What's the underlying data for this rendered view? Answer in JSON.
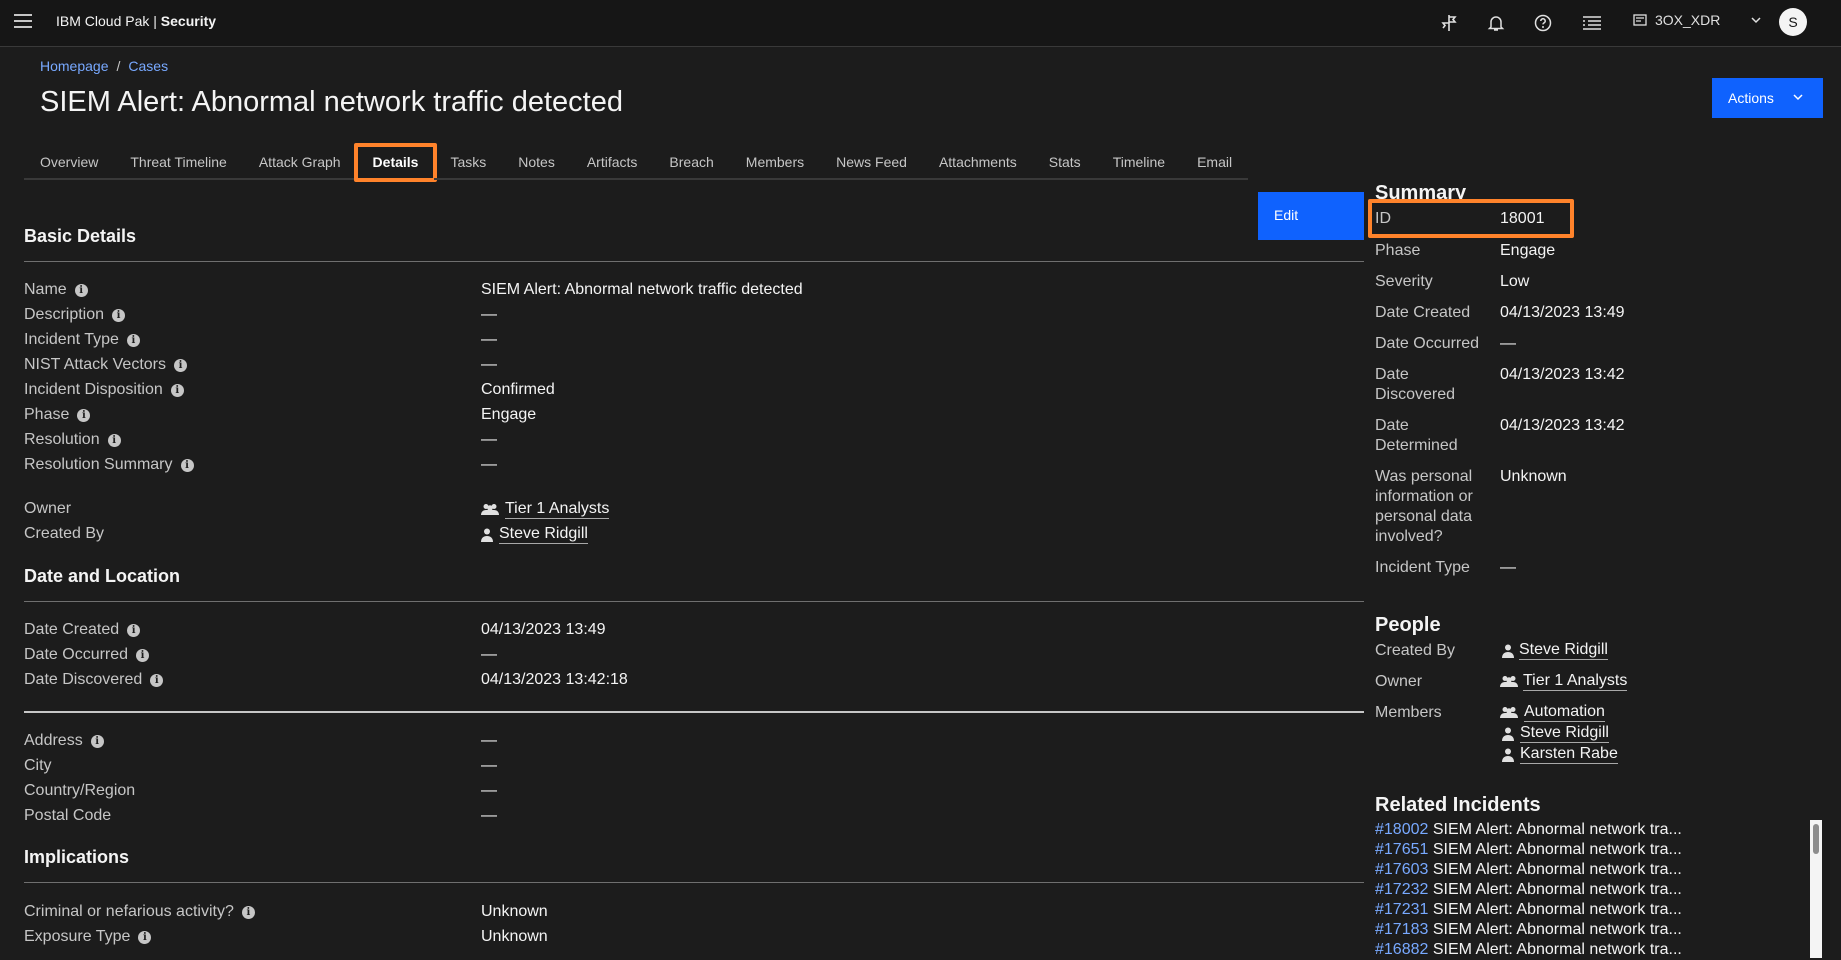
{
  "header": {
    "brand_prefix": "IBM Cloud Pak | ",
    "brand_bold": "Security",
    "account": "3OX_XDR",
    "avatar_initial": "S"
  },
  "breadcrumb": {
    "home": "Homepage",
    "sep": "/",
    "cases": "Cases"
  },
  "page_title": "SIEM Alert: Abnormal network traffic detected",
  "actions_label": "Actions",
  "edit_label": "Edit",
  "tabs": [
    "Overview",
    "Threat Timeline",
    "Attack Graph",
    "Details",
    "Tasks",
    "Notes",
    "Artifacts",
    "Breach",
    "Members",
    "News Feed",
    "Attachments",
    "Stats",
    "Timeline",
    "Email"
  ],
  "active_tab": "Details",
  "basic": {
    "title": "Basic Details",
    "name": {
      "label": "Name",
      "value": "SIEM Alert: Abnormal network traffic detected"
    },
    "description": {
      "label": "Description",
      "value": "—"
    },
    "incident_type": {
      "label": "Incident Type",
      "value": "—"
    },
    "nist": {
      "label": "NIST Attack Vectors",
      "value": "—"
    },
    "disposition": {
      "label": "Incident Disposition",
      "value": "Confirmed"
    },
    "phase": {
      "label": "Phase",
      "value": "Engage"
    },
    "resolution": {
      "label": "Resolution",
      "value": "—"
    },
    "resolution_summary": {
      "label": "Resolution Summary",
      "value": "—"
    },
    "owner": {
      "label": "Owner",
      "value": "Tier 1 Analysts"
    },
    "created_by": {
      "label": "Created By",
      "value": "Steve Ridgill"
    }
  },
  "date_location": {
    "title": "Date and Location",
    "date_created": {
      "label": "Date Created",
      "value": "04/13/2023 13:49"
    },
    "date_occurred": {
      "label": "Date Occurred",
      "value": "—"
    },
    "date_discovered": {
      "label": "Date Discovered",
      "value": "04/13/2023 13:42:18"
    },
    "address": {
      "label": "Address",
      "value": "—"
    },
    "city": {
      "label": "City",
      "value": "—"
    },
    "country": {
      "label": "Country/Region",
      "value": "—"
    },
    "postal": {
      "label": "Postal Code",
      "value": "—"
    }
  },
  "implications": {
    "title": "Implications",
    "criminal": {
      "label": "Criminal or nefarious activity?",
      "value": "Unknown"
    },
    "exposure": {
      "label": "Exposure Type",
      "value": "Unknown"
    }
  },
  "summary": {
    "title": "Summary",
    "id": {
      "label": "ID",
      "value": "18001"
    },
    "phase": {
      "label": "Phase",
      "value": "Engage"
    },
    "severity": {
      "label": "Severity",
      "value": "Low"
    },
    "date_created": {
      "label": "Date Created",
      "value": "04/13/2023 13:49"
    },
    "date_occurred": {
      "label": "Date Occurred",
      "value": "—"
    },
    "date_discovered": {
      "label": "Date Discovered",
      "value": "04/13/2023 13:42"
    },
    "date_determined": {
      "label": "Date Determined",
      "value": "04/13/2023 13:42"
    },
    "personal": {
      "label": "Was personal information or personal data involved?",
      "value": "Unknown"
    },
    "incident_type": {
      "label": "Incident Type",
      "value": "—"
    }
  },
  "people": {
    "title": "People",
    "created_by": {
      "label": "Created By",
      "value": "Steve Ridgill"
    },
    "owner": {
      "label": "Owner",
      "value": "Tier 1 Analysts"
    },
    "members_label": "Members",
    "members": [
      "Automation",
      "Steve Ridgill",
      "Karsten Rabe"
    ]
  },
  "related": {
    "title": "Related Incidents",
    "items": [
      {
        "num": "#18002",
        "text": "SIEM Alert: Abnormal network tra..."
      },
      {
        "num": "#17651",
        "text": "SIEM Alert: Abnormal network tra..."
      },
      {
        "num": "#17603",
        "text": "SIEM Alert: Abnormal network tra..."
      },
      {
        "num": "#17232",
        "text": "SIEM Alert: Abnormal network tra..."
      },
      {
        "num": "#17231",
        "text": "SIEM Alert: Abnormal network tra..."
      },
      {
        "num": "#17183",
        "text": "SIEM Alert: Abnormal network tra..."
      },
      {
        "num": "#16882",
        "text": "SIEM Alert: Abnormal network tra..."
      }
    ]
  }
}
